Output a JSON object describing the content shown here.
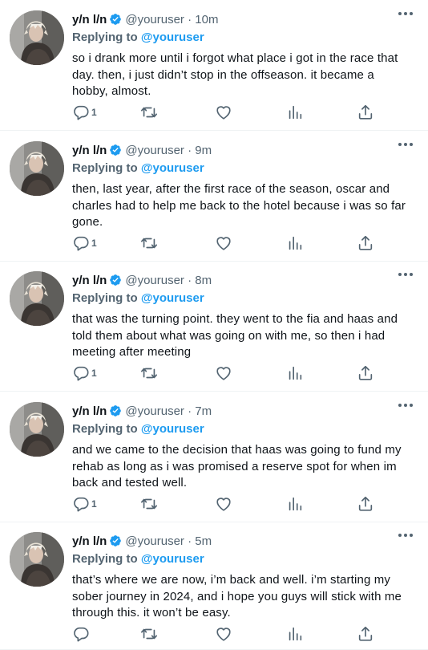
{
  "tweets": [
    {
      "name": "y/n l/n",
      "handle": "@youruser",
      "time": "· 10m",
      "reply_prefix": "Replying to",
      "reply_to": "@youruser",
      "text": "so i drank more until i forgot what place i got in the race that day. then, i just didn’t stop in the offseason. it became a hobby, almost.",
      "reply_count": "1"
    },
    {
      "name": "y/n l/n",
      "handle": "@youruser",
      "time": "· 9m",
      "reply_prefix": "Replying to",
      "reply_to": "@youruser",
      "text": "then, last year, after the first race of the season, oscar and charles had to help me back to the hotel because i was so far gone.",
      "reply_count": "1"
    },
    {
      "name": "y/n l/n",
      "handle": "@youruser",
      "time": "· 8m",
      "reply_prefix": "Replying to",
      "reply_to": "@youruser",
      "text": "that was the turning point. they went to the fia and haas and told them about what was going on with me, so then i had meeting after meeting",
      "reply_count": "1"
    },
    {
      "name": "y/n l/n",
      "handle": "@youruser",
      "time": "· 7m",
      "reply_prefix": "Replying to",
      "reply_to": "@youruser",
      "text": "and we came to the decision that haas was going to fund my rehab as long as i was promised a reserve spot for when im back and tested well.",
      "reply_count": "1"
    },
    {
      "name": "y/n l/n",
      "handle": "@youruser",
      "time": "· 5m",
      "reply_prefix": "Replying to",
      "reply_to": "@youruser",
      "text": "that’s where we are now, i’m back and well. i’m starting my sober journey in 2024, and i hope you guys will stick with me through this. it won’t be easy.",
      "reply_count": ""
    }
  ],
  "colors": {
    "text": "#0f1419",
    "secondary": "#536471",
    "accent": "#1d9bf0"
  },
  "icons": [
    "verified-badge-icon",
    "more-icon",
    "reply-icon",
    "retweet-icon",
    "like-icon",
    "views-icon",
    "share-icon"
  ]
}
